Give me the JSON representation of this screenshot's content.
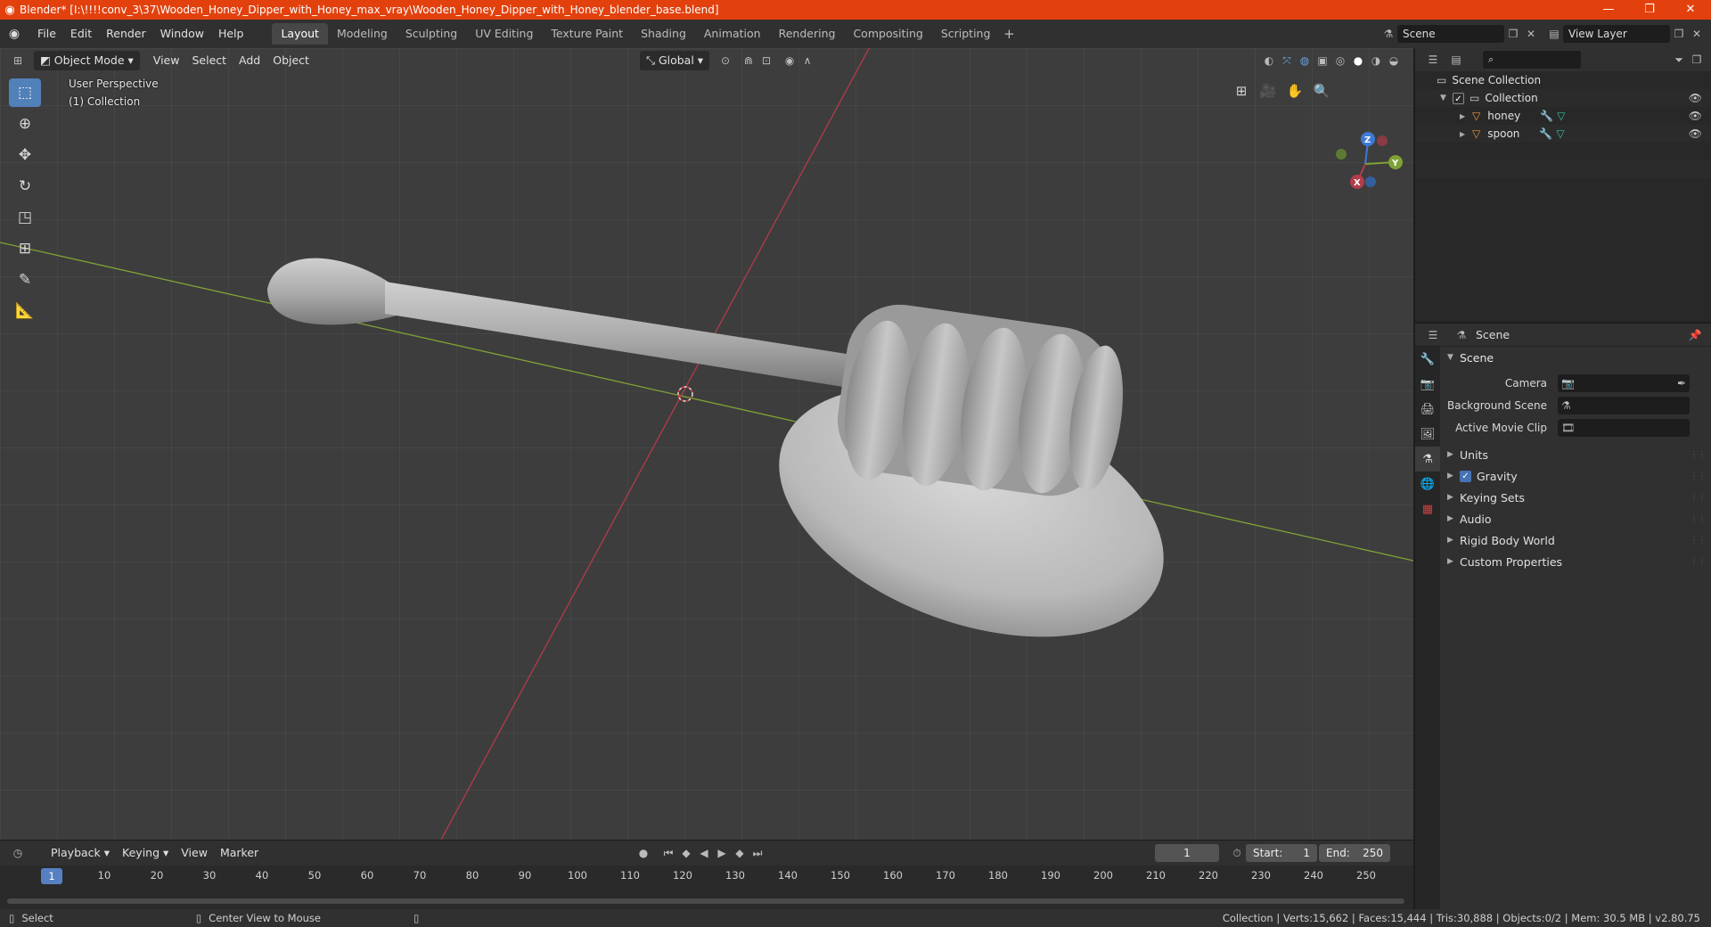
{
  "window": {
    "title": "Blender* [I:\\!!!!conv_3\\37\\Wooden_Honey_Dipper_with_Honey_max_vray\\Wooden_Honey_Dipper_with_Honey_blender_base.blend]",
    "minimize": "—",
    "maximize": "❐",
    "close": "✕"
  },
  "menu": [
    "File",
    "Edit",
    "Render",
    "Window",
    "Help"
  ],
  "workspaces": [
    "Layout",
    "Modeling",
    "Sculpting",
    "UV Editing",
    "Texture Paint",
    "Shading",
    "Animation",
    "Rendering",
    "Compositing",
    "Scripting"
  ],
  "active_workspace": "Layout",
  "scene_selector": {
    "scene": "Scene",
    "view_layer": "View Layer"
  },
  "viewport": {
    "mode": "Object Mode",
    "menus": [
      "View",
      "Select",
      "Add",
      "Object"
    ],
    "transform_orientation": "Global",
    "perspective": "User Perspective",
    "collection": "(1) Collection",
    "gizmo": {
      "x": "X",
      "y": "Y",
      "z": "Z"
    }
  },
  "timeline": {
    "menus": [
      "Playback",
      "Keying",
      "View",
      "Marker"
    ],
    "current_frame": "1",
    "start_label": "Start:",
    "start": "1",
    "end_label": "End:",
    "end": "250",
    "ruler": [
      "10",
      "20",
      "30",
      "40",
      "50",
      "60",
      "70",
      "80",
      "90",
      "100",
      "110",
      "120",
      "130",
      "140",
      "150",
      "160",
      "170",
      "180",
      "190",
      "200",
      "210",
      "220",
      "230",
      "240",
      "250"
    ]
  },
  "statusbar": {
    "left_action": "Select",
    "middle_action": "Center View to Mouse",
    "stats": "Collection | Verts:15,662 | Faces:15,444 | Tris:30,888 | Objects:0/2 | Mem: 30.5 MB | v2.80.75"
  },
  "outliner": {
    "root": "Scene Collection",
    "collection": "Collection",
    "objects": [
      "honey",
      "spoon"
    ]
  },
  "properties": {
    "context": "Scene",
    "panel": "Scene",
    "rows": [
      {
        "label": "Camera"
      },
      {
        "label": "Background Scene"
      },
      {
        "label": "Active Movie Clip"
      }
    ],
    "subpanels": [
      "Units",
      "Gravity",
      "Keying Sets",
      "Audio",
      "Rigid Body World",
      "Custom Properties"
    ]
  },
  "colors": {
    "titlebar": "#e2410e",
    "accent": "#4772b3",
    "x_axis": "#b33b4a",
    "y_axis": "#7fa236",
    "z_axis": "#3d7ad6",
    "object_icon": "#e8953a",
    "mesh_icon": "#30c0a0"
  }
}
